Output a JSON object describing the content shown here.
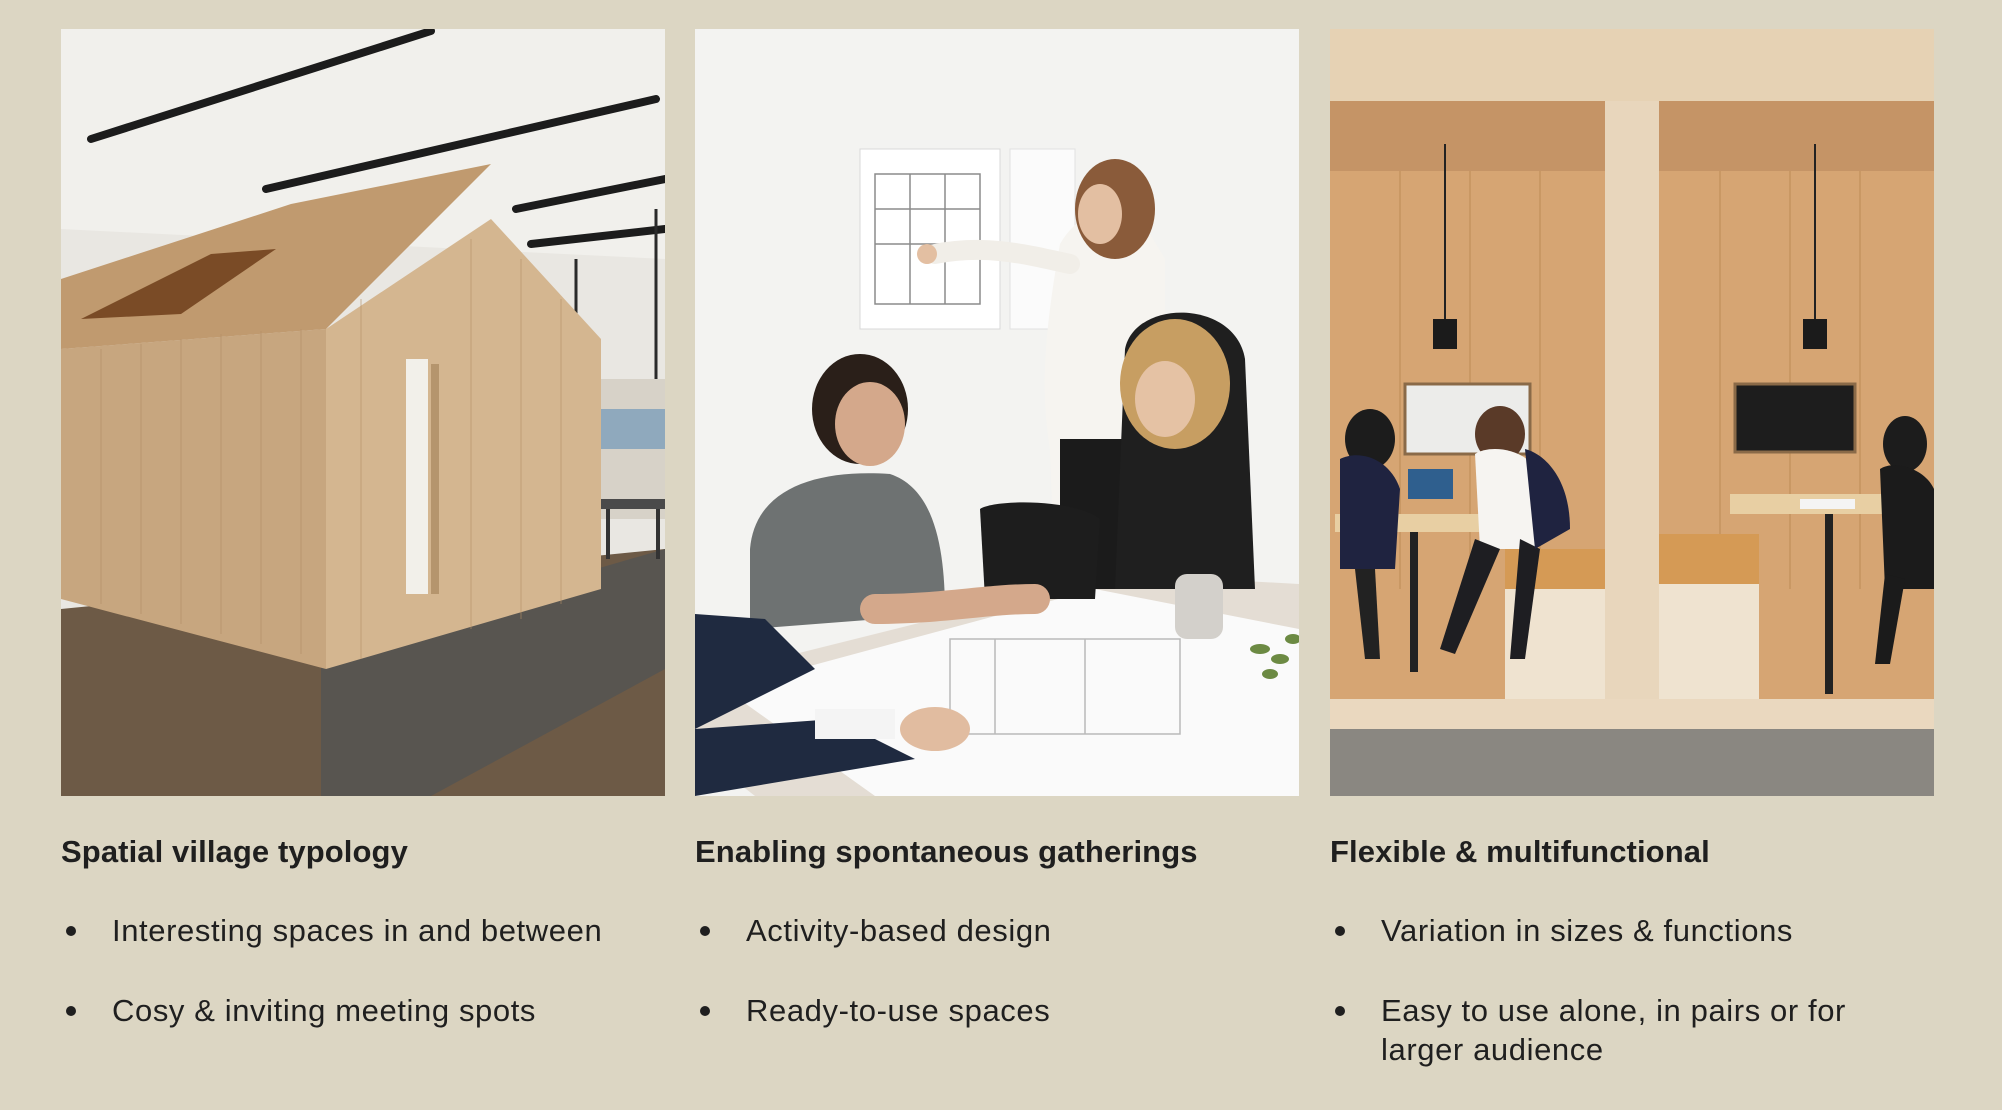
{
  "columns": [
    {
      "image_subject": "wooden-cabin-photo",
      "heading": "Spatial village typology",
      "bullets": [
        "Interesting spaces in and between",
        "Cosy & inviting meeting spots"
      ]
    },
    {
      "image_subject": "team-meeting-photo",
      "heading": "Enabling spontaneous gatherings",
      "bullets": [
        "Activity-based design",
        "Ready-to-use spaces"
      ]
    },
    {
      "image_subject": "meeting-booths-photo",
      "heading": "Flexible & multifunctional",
      "bullets": [
        "Variation in sizes & functions",
        "Easy to use alone, in pairs or for larger audience"
      ]
    }
  ],
  "colors": {
    "background": "#dcd6c3",
    "text": "#1f1f1f",
    "wood": "#c9a37a"
  }
}
